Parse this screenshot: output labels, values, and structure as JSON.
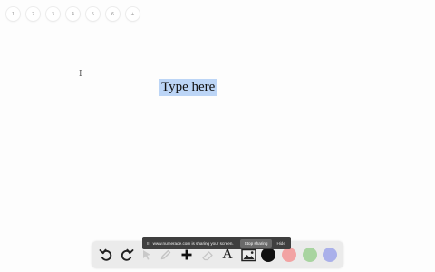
{
  "pages": [
    "1",
    "2",
    "3",
    "4",
    "5",
    "6",
    "+"
  ],
  "cursor_glyph": "I",
  "canvas": {
    "text": "Type here"
  },
  "share_bar": {
    "pause_glyph": "II",
    "message": "www.numerade.com is sharing your screen.",
    "stop_label": "Stop sharing",
    "hide_label": "Hide"
  },
  "toolbar": {
    "text_tool_glyph": "A",
    "tools": [
      "undo-icon",
      "redo-icon",
      "pointer-icon",
      "pen-icon",
      "add-icon",
      "eraser-icon",
      "text-icon",
      "image-icon"
    ],
    "colors": [
      "#111111",
      "#f2a3a3",
      "#a8d4a0",
      "#aab0ea"
    ]
  }
}
